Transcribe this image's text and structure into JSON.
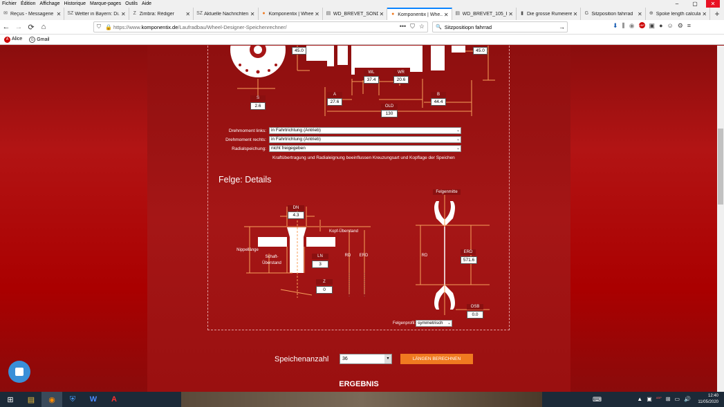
{
  "menu": [
    "Fichier",
    "Édition",
    "Affichage",
    "Historique",
    "Marque-pages",
    "Outils",
    "Aide"
  ],
  "window_buttons": {
    "minimize": "–",
    "maximize": "▢",
    "close": "✕"
  },
  "tabs": [
    {
      "label": "Reçus - Messagerie",
      "icon": "envelope-icon",
      "glyph": "✉"
    },
    {
      "label": "Wetter in Bayern: Di...",
      "icon": "sz-icon",
      "glyph": "SZ"
    },
    {
      "label": "Zimbra: Rédiger",
      "icon": "zimbra-icon",
      "glyph": "Z"
    },
    {
      "label": "Aktuelle Nachrichten",
      "icon": "sz-icon",
      "glyph": "SZ"
    },
    {
      "label": "Komponentix | Wheel",
      "icon": "komponentix-icon",
      "glyph": "●"
    },
    {
      "label": "WD_BREVET_SONDER",
      "icon": "doc-icon",
      "glyph": "▤"
    },
    {
      "label": "Komponentix | Whe...",
      "icon": "komponentix-icon",
      "glyph": "●",
      "active": true
    },
    {
      "label": "WD_BREVET_105_FH",
      "icon": "doc-icon",
      "glyph": "▤"
    },
    {
      "label": "Die grosse Rumeiere",
      "icon": "bookmark-icon",
      "glyph": "▮"
    },
    {
      "label": "Sitzposition fahrrad",
      "icon": "google-icon",
      "glyph": "G"
    },
    {
      "label": "Spoke length calcula",
      "icon": "globe-icon",
      "glyph": "⊕"
    }
  ],
  "new_tab": "+",
  "nav": {
    "back": "←",
    "forward": "→",
    "reload": "⟳",
    "home": "⌂"
  },
  "url": {
    "prefix": "https://www.",
    "domain": "komponentix.de",
    "path": "/Laufradbau/Wheel-Designer-Speichenrechner/"
  },
  "url_icons": [
    "•••",
    "⛉",
    "☆"
  ],
  "search": {
    "value": "Sitzpositiopn fahrrad",
    "icon": "🔍",
    "go": "→"
  },
  "toolbar_icons": [
    "⬇",
    "⫼",
    "◉",
    "ABP",
    "▣",
    "●",
    "☺",
    "⚙",
    "≡"
  ],
  "bookmarks": [
    {
      "label": "Alice",
      "icon_text": "A"
    },
    {
      "label": "Gmail",
      "icon_text": "G"
    }
  ],
  "hub": {
    "values": {
      "flange_left": "45.0",
      "flange_right": "45.0",
      "wl": "37.4",
      "wr": "20.6",
      "a": "27.6",
      "b": "44.4",
      "old": "130",
      "s": "2.6"
    },
    "labels": {
      "wl": "WL",
      "wr": "WR",
      "a": "A",
      "b": "B",
      "old": "OLD",
      "s": "S"
    }
  },
  "fields": [
    {
      "label": "Drehmoment links:",
      "value": "in Fahrtrichtung (Antrieb)"
    },
    {
      "label": "Drehmoment rechts:",
      "value": "in Fahrtrichtung (Antrieb)"
    },
    {
      "label": "Radialspeichung:",
      "value": "nicht freigegeben"
    }
  ],
  "select_arrow": "⌄",
  "note": "Kraftübertragung und Radialeignung beeinflussen Kreuzungsart und Kopflage der Speichen",
  "rim_heading": "Felge: Details",
  "rim": {
    "dn_label": "DN",
    "dn_value": "4.3",
    "kopf_label": "Kopf-Überstand",
    "nippel_label": "Nippellänge",
    "schaft_label": "Schaft-Überstand",
    "ln_label": "LN",
    "ln_value": "3",
    "rd_label": "RD",
    "erd_label": "ERD",
    "z_label": "Z",
    "z_value": "0",
    "felgenmitte_label": "Felgenmitte",
    "rd_label2": "RD",
    "erd_label2": "ERD",
    "erd_value": "571.6",
    "osb_label": "OSB",
    "osb_value": "0.0",
    "profil_label": "Felgenprofil:",
    "profil_value": "symmetrisch"
  },
  "spokes": {
    "label": "Speichenanzahl",
    "value": "36",
    "arrow": "▾",
    "button": "LÄNGEN BERECHNEN"
  },
  "result_heading": "ERGEBNIS",
  "taskbar": {
    "items": [
      "⊞",
      "▤",
      "◉",
      "⛨",
      "W",
      "A"
    ],
    "time": "12:40",
    "date": "11/05/2020",
    "tray": [
      "⌨",
      "▲",
      "▣",
      "ABP",
      "⊞",
      "▭",
      "🔊"
    ]
  }
}
